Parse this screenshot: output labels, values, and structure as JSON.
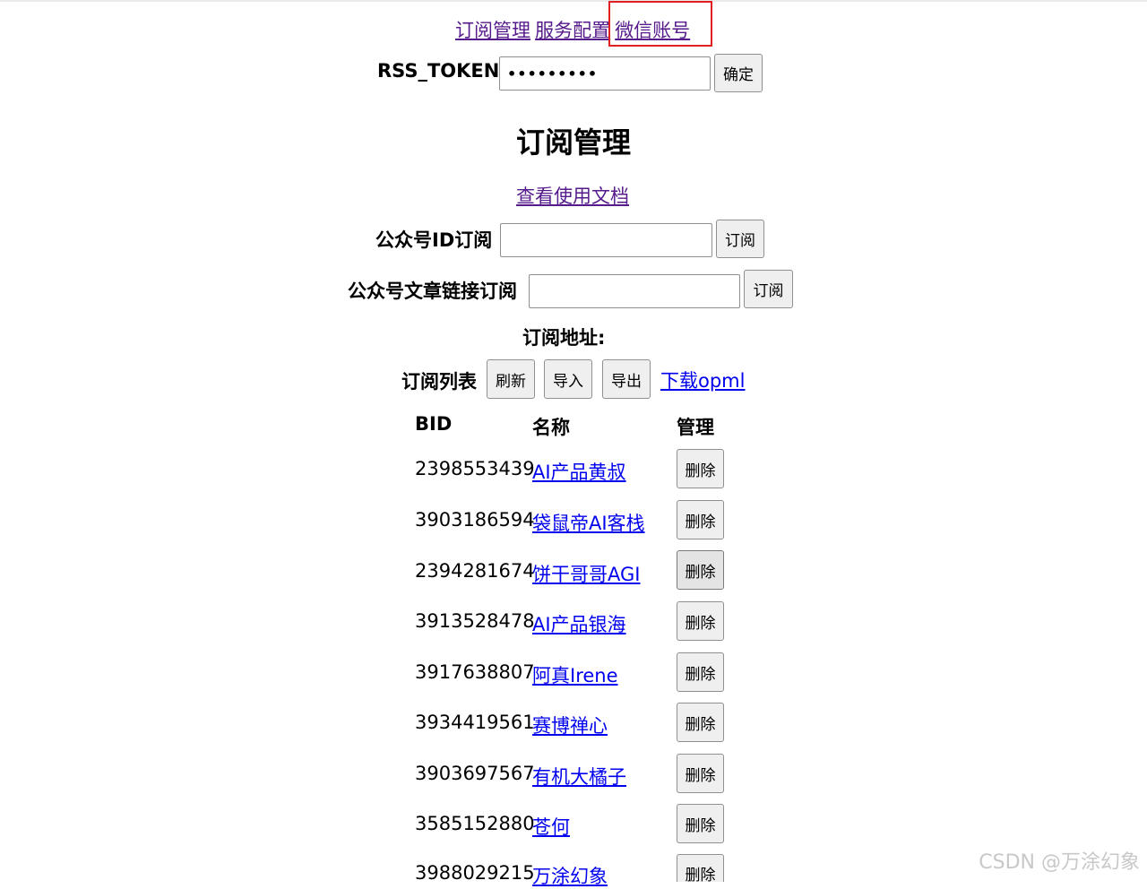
{
  "nav": {
    "items": [
      {
        "label": "订阅管理"
      },
      {
        "label": "服务配置"
      },
      {
        "label": "微信账号"
      }
    ]
  },
  "token": {
    "label": "RSS_TOKEN",
    "value": "•••••••••",
    "confirm_label": "确定"
  },
  "main": {
    "title": "订阅管理",
    "docs_link": "查看使用文档",
    "id_subscribe": {
      "label": "公众号ID订阅",
      "value": "",
      "button": "订阅"
    },
    "link_subscribe": {
      "label": "公众号文章链接订阅",
      "value": "",
      "button": "订阅"
    },
    "address_label": "订阅地址:",
    "list_label": "订阅列表",
    "refresh_label": "刷新",
    "import_label": "导入",
    "export_label": "导出",
    "opml_link": "下载opml"
  },
  "table": {
    "headers": [
      "BID",
      "名称",
      "管理"
    ],
    "delete_label": "删除",
    "rows": [
      {
        "bid": "2398553439",
        "name": "AI产品黄叔"
      },
      {
        "bid": "3903186594",
        "name": "袋鼠帝AI客栈"
      },
      {
        "bid": "2394281674",
        "name": "饼干哥哥AGI"
      },
      {
        "bid": "3913528478",
        "name": "AI产品银海"
      },
      {
        "bid": "3917638807",
        "name": "阿真Irene"
      },
      {
        "bid": "3934419561",
        "name": "赛博禅心"
      },
      {
        "bid": "3903697567",
        "name": "有机大橘子"
      },
      {
        "bid": "3585152880",
        "name": "苍何"
      },
      {
        "bid": "3988029215",
        "name": "万涂幻象"
      }
    ]
  },
  "watermark": "CSDN @万涂幻象",
  "colors": {
    "link": "#0000ee",
    "visited": "#551a8b",
    "highlight": "#e02020"
  }
}
